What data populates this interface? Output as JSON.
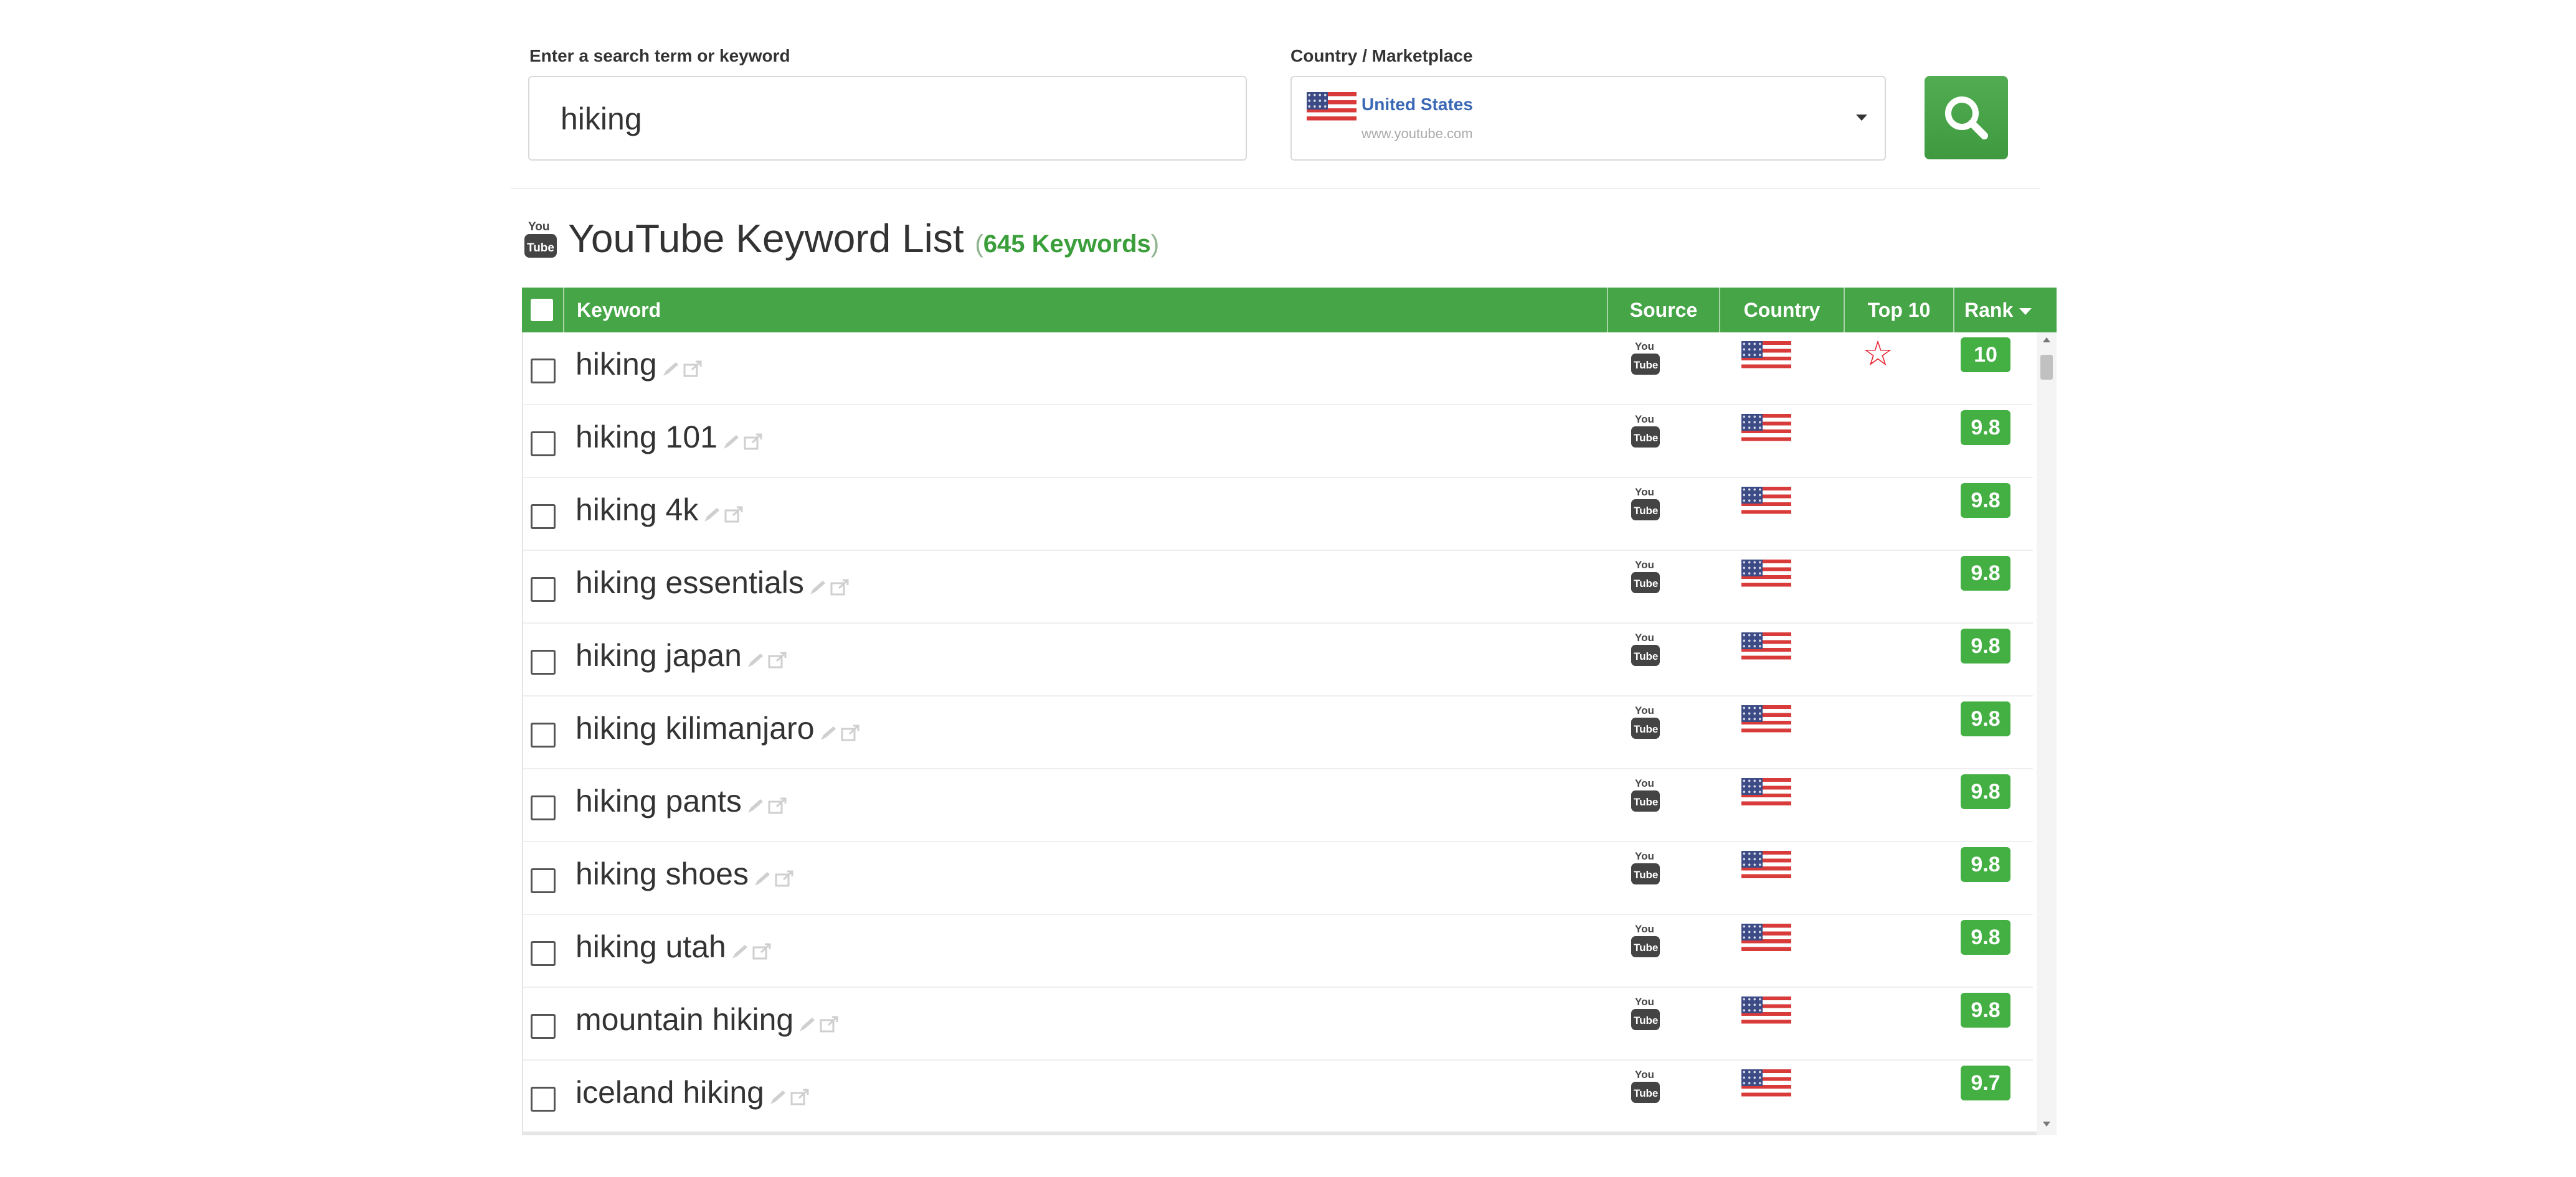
{
  "search": {
    "term_label": "Enter a search term or keyword",
    "term_value": "hiking",
    "country_label": "Country / Marketplace",
    "country_name": "United States",
    "country_domain": "www.youtube.com"
  },
  "list": {
    "title": "YouTube Keyword List",
    "count_open": "(",
    "count_text": "645 Keywords",
    "count_close": ")"
  },
  "table": {
    "columns": {
      "keyword": "Keyword",
      "source": "Source",
      "country": "Country",
      "top10": "Top 10",
      "rank": "Rank"
    },
    "rows": [
      {
        "keyword": "hiking",
        "rank": "10",
        "top10": true
      },
      {
        "keyword": "hiking 101",
        "rank": "9.8",
        "top10": false
      },
      {
        "keyword": "hiking 4k",
        "rank": "9.8",
        "top10": false
      },
      {
        "keyword": "hiking essentials",
        "rank": "9.8",
        "top10": false
      },
      {
        "keyword": "hiking japan",
        "rank": "9.8",
        "top10": false
      },
      {
        "keyword": "hiking kilimanjaro",
        "rank": "9.8",
        "top10": false
      },
      {
        "keyword": "hiking pants",
        "rank": "9.8",
        "top10": false
      },
      {
        "keyword": "hiking shoes",
        "rank": "9.8",
        "top10": false
      },
      {
        "keyword": "hiking utah",
        "rank": "9.8",
        "top10": false
      },
      {
        "keyword": "mountain hiking",
        "rank": "9.8",
        "top10": false
      },
      {
        "keyword": "iceland hiking",
        "rank": "9.7",
        "top10": false
      }
    ]
  },
  "icons": {
    "source": "youtube-icon",
    "country": "us-flag-icon",
    "top10": "star-outline-icon",
    "edit": "pencil-icon",
    "open": "external-link-icon",
    "search": "magnifier-icon"
  },
  "colors": {
    "header_green": "#46a546",
    "rank_green": "#44b044",
    "star_red": "#e8202a",
    "country_link": "#3a68b5"
  }
}
